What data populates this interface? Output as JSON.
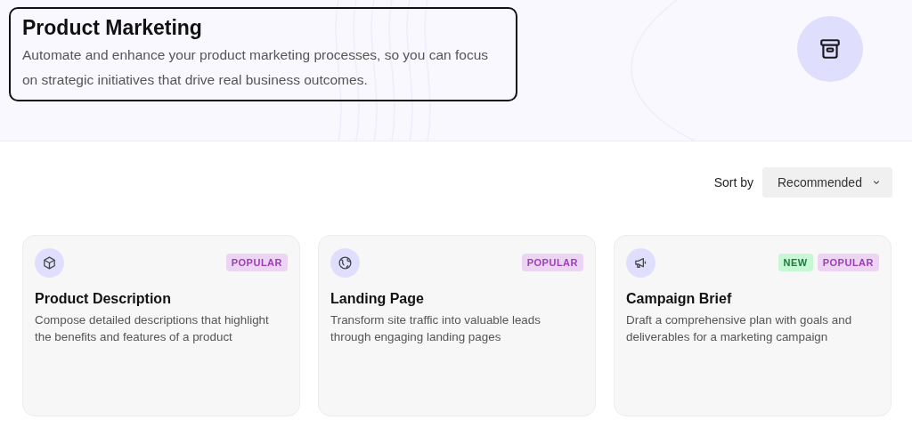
{
  "header": {
    "title": "Product Marketing",
    "description": "Automate and enhance your product marketing processes, so you can focus on strategic initiatives that drive real business outcomes."
  },
  "sort": {
    "label": "Sort by",
    "value": "Recommended"
  },
  "cards": [
    {
      "title": "Product Description",
      "description": "Compose detailed descriptions that highlight the benefits and features of a product",
      "badges": [
        {
          "kind": "popular",
          "label": "POPULAR"
        }
      ]
    },
    {
      "title": "Landing Page",
      "description": "Transform site traffic into valuable leads through engaging landing pages",
      "badges": [
        {
          "kind": "popular",
          "label": "POPULAR"
        }
      ]
    },
    {
      "title": "Campaign Brief",
      "description": "Draft a comprehensive plan with goals and deliverables for a marketing campaign",
      "badges": [
        {
          "kind": "new",
          "label": "NEW"
        },
        {
          "kind": "popular",
          "label": "POPULAR"
        }
      ]
    }
  ]
}
